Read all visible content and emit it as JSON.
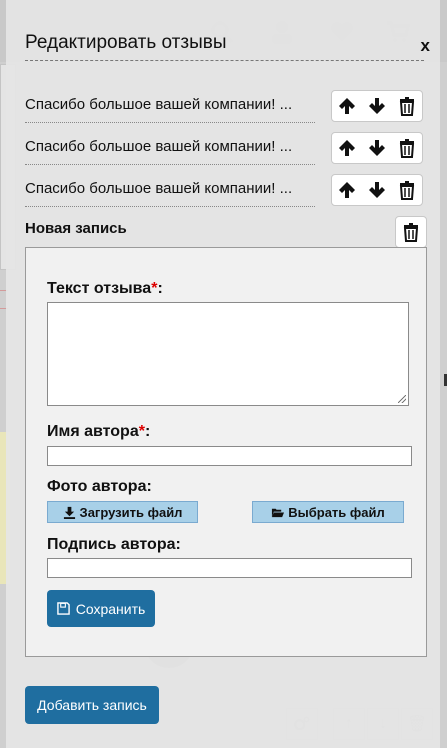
{
  "panel": {
    "title": "Редактировать отзывы",
    "close_label": "x"
  },
  "reviews": [
    {
      "text": "Спасибо большое вашей компании! ..."
    },
    {
      "text": "Спасибо большое вашей компании! ..."
    },
    {
      "text": "Спасибо большое вашей компании! ..."
    }
  ],
  "new_entry": {
    "label": "Новая запись"
  },
  "form": {
    "review_text_label": "Текст отзыва",
    "author_name_label": "Имя автора",
    "required_mark": "*",
    "colon": ":",
    "author_photo_label": "Фото автора:",
    "upload_label": "Загрузить файл",
    "choose_label": "Выбрать файл",
    "author_signature_label": "Подпись автора:",
    "save_label": "Сохранить",
    "review_text_value": "",
    "author_name_value": "",
    "author_signature_value": ""
  },
  "add_button_label": "Добавить запись",
  "icons": {
    "up": "arrow-up-icon",
    "down": "arrow-down-icon",
    "delete": "trash-icon",
    "upload": "download-icon",
    "folder": "folder-open-icon",
    "save": "floppy-disk-icon"
  },
  "colors": {
    "primary_button": "#1f6ea0",
    "file_button": "#a8d0e8",
    "required": "#dd0000"
  }
}
